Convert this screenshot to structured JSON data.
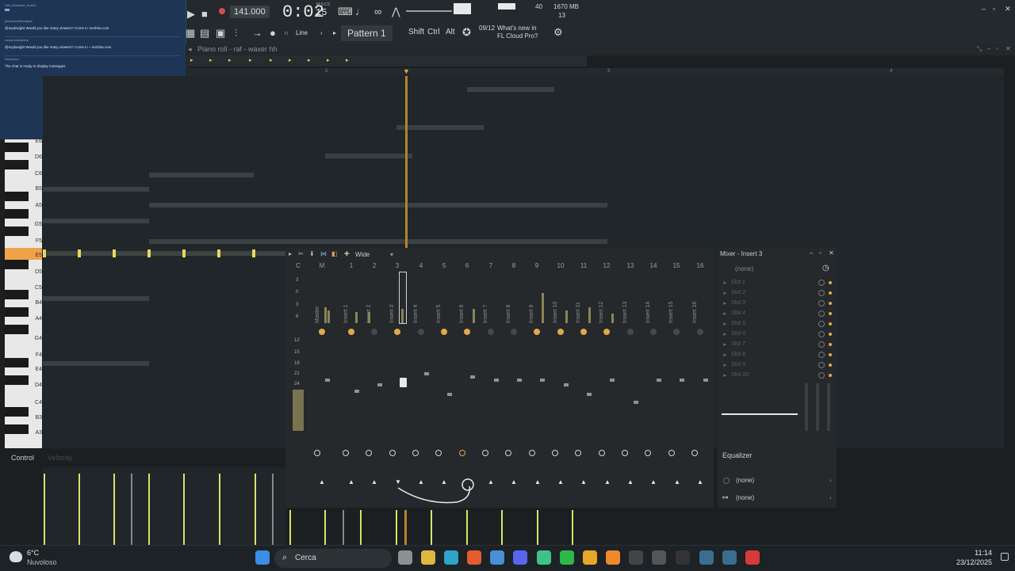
{
  "toolbar": {
    "tempo": "141.000",
    "time": "0:02",
    "time_sub": "15",
    "time_unit": "M:S:CS",
    "snap_mode": "Line",
    "pattern": "Pattern 1",
    "modifier_shift": "Shift",
    "modifier_ctrl": "Ctrl",
    "modifier_alt": "Alt",
    "news_date": "09/12",
    "news_title": "What's new in FL Cloud Pro?",
    "cpu_value": "40",
    "memory": "1670 MB",
    "voices": "13"
  },
  "chat": {
    "header_user": "Heli_Ariiiustae_Aurelo",
    "messages": [
      {
        "user": "jesseyaveteeralipse",
        "text": "@mydavight Would you like many viewers? Come in  'nezbha.com"
      },
      {
        "user": "volaybveshdcent",
        "text": "@mydavight Would you like many viewers? Come in ~ nezbha.com"
      },
      {
        "user": "Sokricavo",
        "text": "The chat is ready to display messages"
      }
    ]
  },
  "piano_roll": {
    "title": "Piano roll - raf - waxer hh",
    "bar_numbers": [
      "2",
      "3",
      "4"
    ],
    "keys": [
      "E6",
      "D6",
      "C6",
      "B5",
      "A5",
      "G5",
      "F5",
      "E5",
      "D5",
      "C5",
      "B4",
      "A4",
      "G4",
      "F4",
      "E4",
      "D4",
      "C4",
      "B3",
      "A3"
    ],
    "control_label": "Control",
    "control_param": "Velocity"
  },
  "mixer": {
    "title": "Mixer - Insert 3",
    "view_mode": "Wide",
    "strip_headers": [
      "C",
      "M",
      "1",
      "2",
      "3",
      "4",
      "5",
      "6",
      "7",
      "8",
      "9",
      "10",
      "11",
      "12",
      "13",
      "14",
      "15",
      "16"
    ],
    "strip_names": [
      "Master",
      "Insert 1",
      "Insert 2",
      "Insert 3",
      "Insert 4",
      "Insert 5",
      "Insert 6",
      "Insert 7",
      "Insert 8",
      "Insert 9",
      "Insert 10",
      "Insert 11",
      "Insert 12",
      "Insert 13",
      "Insert 14",
      "Insert 15",
      "Insert 16"
    ],
    "db_scale": [
      "3",
      "0",
      "3",
      "6",
      "12",
      "15",
      "18",
      "21",
      "24"
    ],
    "input_none": "(none)",
    "slots": [
      "Slot 1",
      "Slot 2",
      "Slot 3",
      "Slot 4",
      "Slot 5",
      "Slot 6",
      "Slot 7",
      "Slot 8",
      "Slot 9",
      "Slot 10"
    ],
    "equalizer_label": "Equalizer",
    "output_none_1": "(none)",
    "output_none_2": "(none)"
  },
  "taskbar": {
    "weather_temp": "6°C",
    "weather_desc": "Nuvoloso",
    "search_placeholder": "Cerca",
    "clock_time": "11:14",
    "clock_date": "23/12/2025"
  },
  "colors": {
    "accent": "#e2a94a",
    "playhead": "#f0a838",
    "event": "#d9e265"
  },
  "icons": [
    "windows-icon",
    "search-icon",
    "folder-icon",
    "edge-icon",
    "brave-icon",
    "chrome-icon",
    "discord-icon",
    "terminal-icon",
    "spotify-icon",
    "fl-studio-icon",
    "settings-icon"
  ]
}
